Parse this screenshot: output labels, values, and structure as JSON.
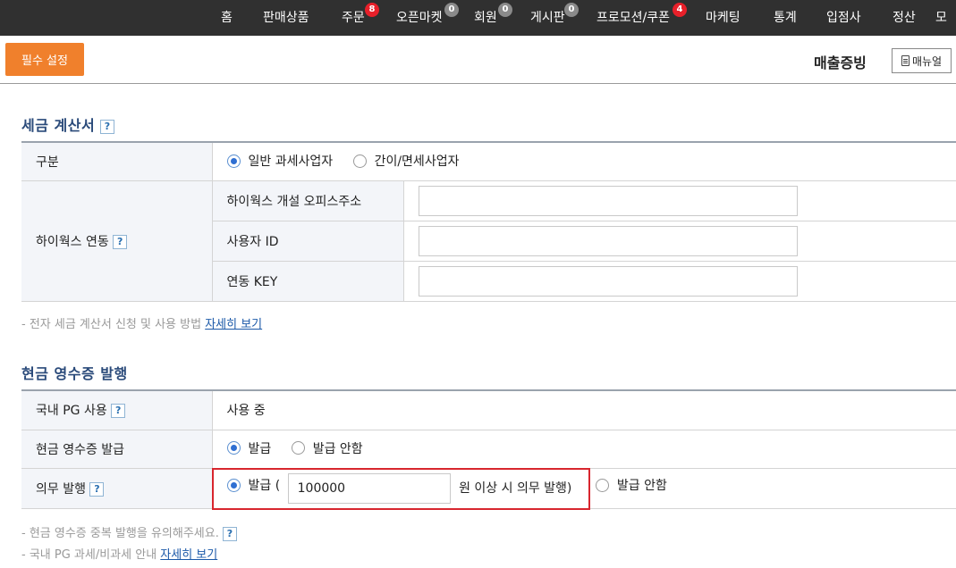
{
  "topnav": {
    "items": [
      {
        "label": "홈"
      },
      {
        "label": "판매상품"
      },
      {
        "label": "주문",
        "badge": "8"
      },
      {
        "label": "오픈마켓",
        "badge": "0"
      },
      {
        "label": "회원",
        "badge": "0"
      },
      {
        "label": "게시판",
        "badge": "0"
      },
      {
        "label": "프로모션/쿠폰",
        "badge": "4"
      },
      {
        "label": "마케팅"
      },
      {
        "label": "통계"
      },
      {
        "label": "입점사"
      },
      {
        "label": "정산"
      },
      {
        "label": "모"
      }
    ]
  },
  "header": {
    "required_button": "필수 설정",
    "title": "매출증빙",
    "manual_button": "매뉴얼"
  },
  "tax_invoice": {
    "title": "세금 계산서",
    "help": "?",
    "type_label": "구분",
    "type_options": [
      "일반 과세사업자",
      "간이/면세사업자"
    ],
    "hiworks_label": "하이웍스 연동",
    "hiworks_fields": [
      {
        "label": "하이웍스 개설 오피스주소",
        "value": ""
      },
      {
        "label": "사용자 ID",
        "value": ""
      },
      {
        "label": "연동 KEY",
        "value": ""
      }
    ],
    "note_prefix": "- 전자 세금 계산서 신청 및 사용 방법",
    "note_link": "자세히 보기"
  },
  "cash_receipt": {
    "title": "현금 영수증 발행",
    "pg_label": "국내 PG 사용",
    "pg_value": "사용 중",
    "issue_label": "현금 영수증 발급",
    "issue_options": [
      "발급",
      "발급 안함"
    ],
    "mandatory_label": "의무 발행",
    "mandatory_issue": "발급 (",
    "mandatory_amount": "100000",
    "mandatory_suffix": "원 이상 시 의무 발행)",
    "mandatory_no": "발급 안함",
    "note1": "- 현금 영수증 중복 발행을 유의해주세요.",
    "note2_prefix": "- 국내 PG 과세/비과세 안내",
    "note2_link": "자세히 보기"
  }
}
